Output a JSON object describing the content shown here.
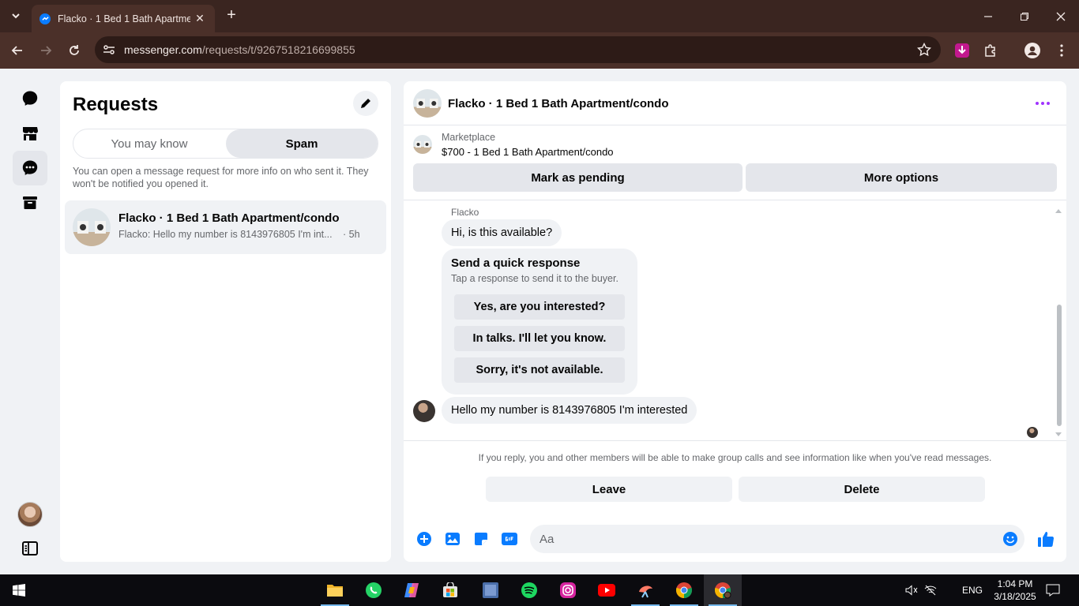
{
  "browser": {
    "tab_title": "Flacko · 1 Bed 1 Bath Apartment/condo",
    "url_host": "messenger.com",
    "url_path": "/requests/t/9267518216699855"
  },
  "requests": {
    "title": "Requests",
    "tabs": [
      "You may know",
      "Spam"
    ],
    "active_tab": "Spam",
    "info": "You can open a message request for more info on who sent it. They won't be notified you opened it.",
    "items": [
      {
        "name": "Flacko · 1 Bed 1 Bath Apartment/condo",
        "snippet": "Flacko: Hello my number is 8143976805 I'm int...",
        "time": "· 5h"
      }
    ]
  },
  "chat": {
    "title": "Flacko · 1 Bed 1 Bath Apartment/condo",
    "marketplace_label": "Marketplace",
    "listing": "$700 - 1 Bed 1 Bath Apartment/condo",
    "mark_pending": "Mark as pending",
    "more_options": "More options",
    "sender_name": "Flacko",
    "messages": [
      "Hi, is this available?",
      "Hello my number is 8143976805 I'm interested"
    ],
    "quick_response": {
      "title": "Send a quick response",
      "subtitle": "Tap a response to send it to the buyer.",
      "options": [
        "Yes, are you interested?",
        "In talks. I'll let you know.",
        "Sorry, it's not available."
      ]
    },
    "notice": "If you reply, you and other members will be able to make group calls and see information like when you've read messages.",
    "leave": "Leave",
    "delete": "Delete",
    "composer_placeholder": "Aa"
  },
  "taskbar": {
    "lang": "ENG",
    "time": "1:04 PM",
    "date": "3/18/2025"
  },
  "colors": {
    "accent": "#0a7cff",
    "more_dots": "#a033ff",
    "chrome_bg": "#3a2520"
  }
}
